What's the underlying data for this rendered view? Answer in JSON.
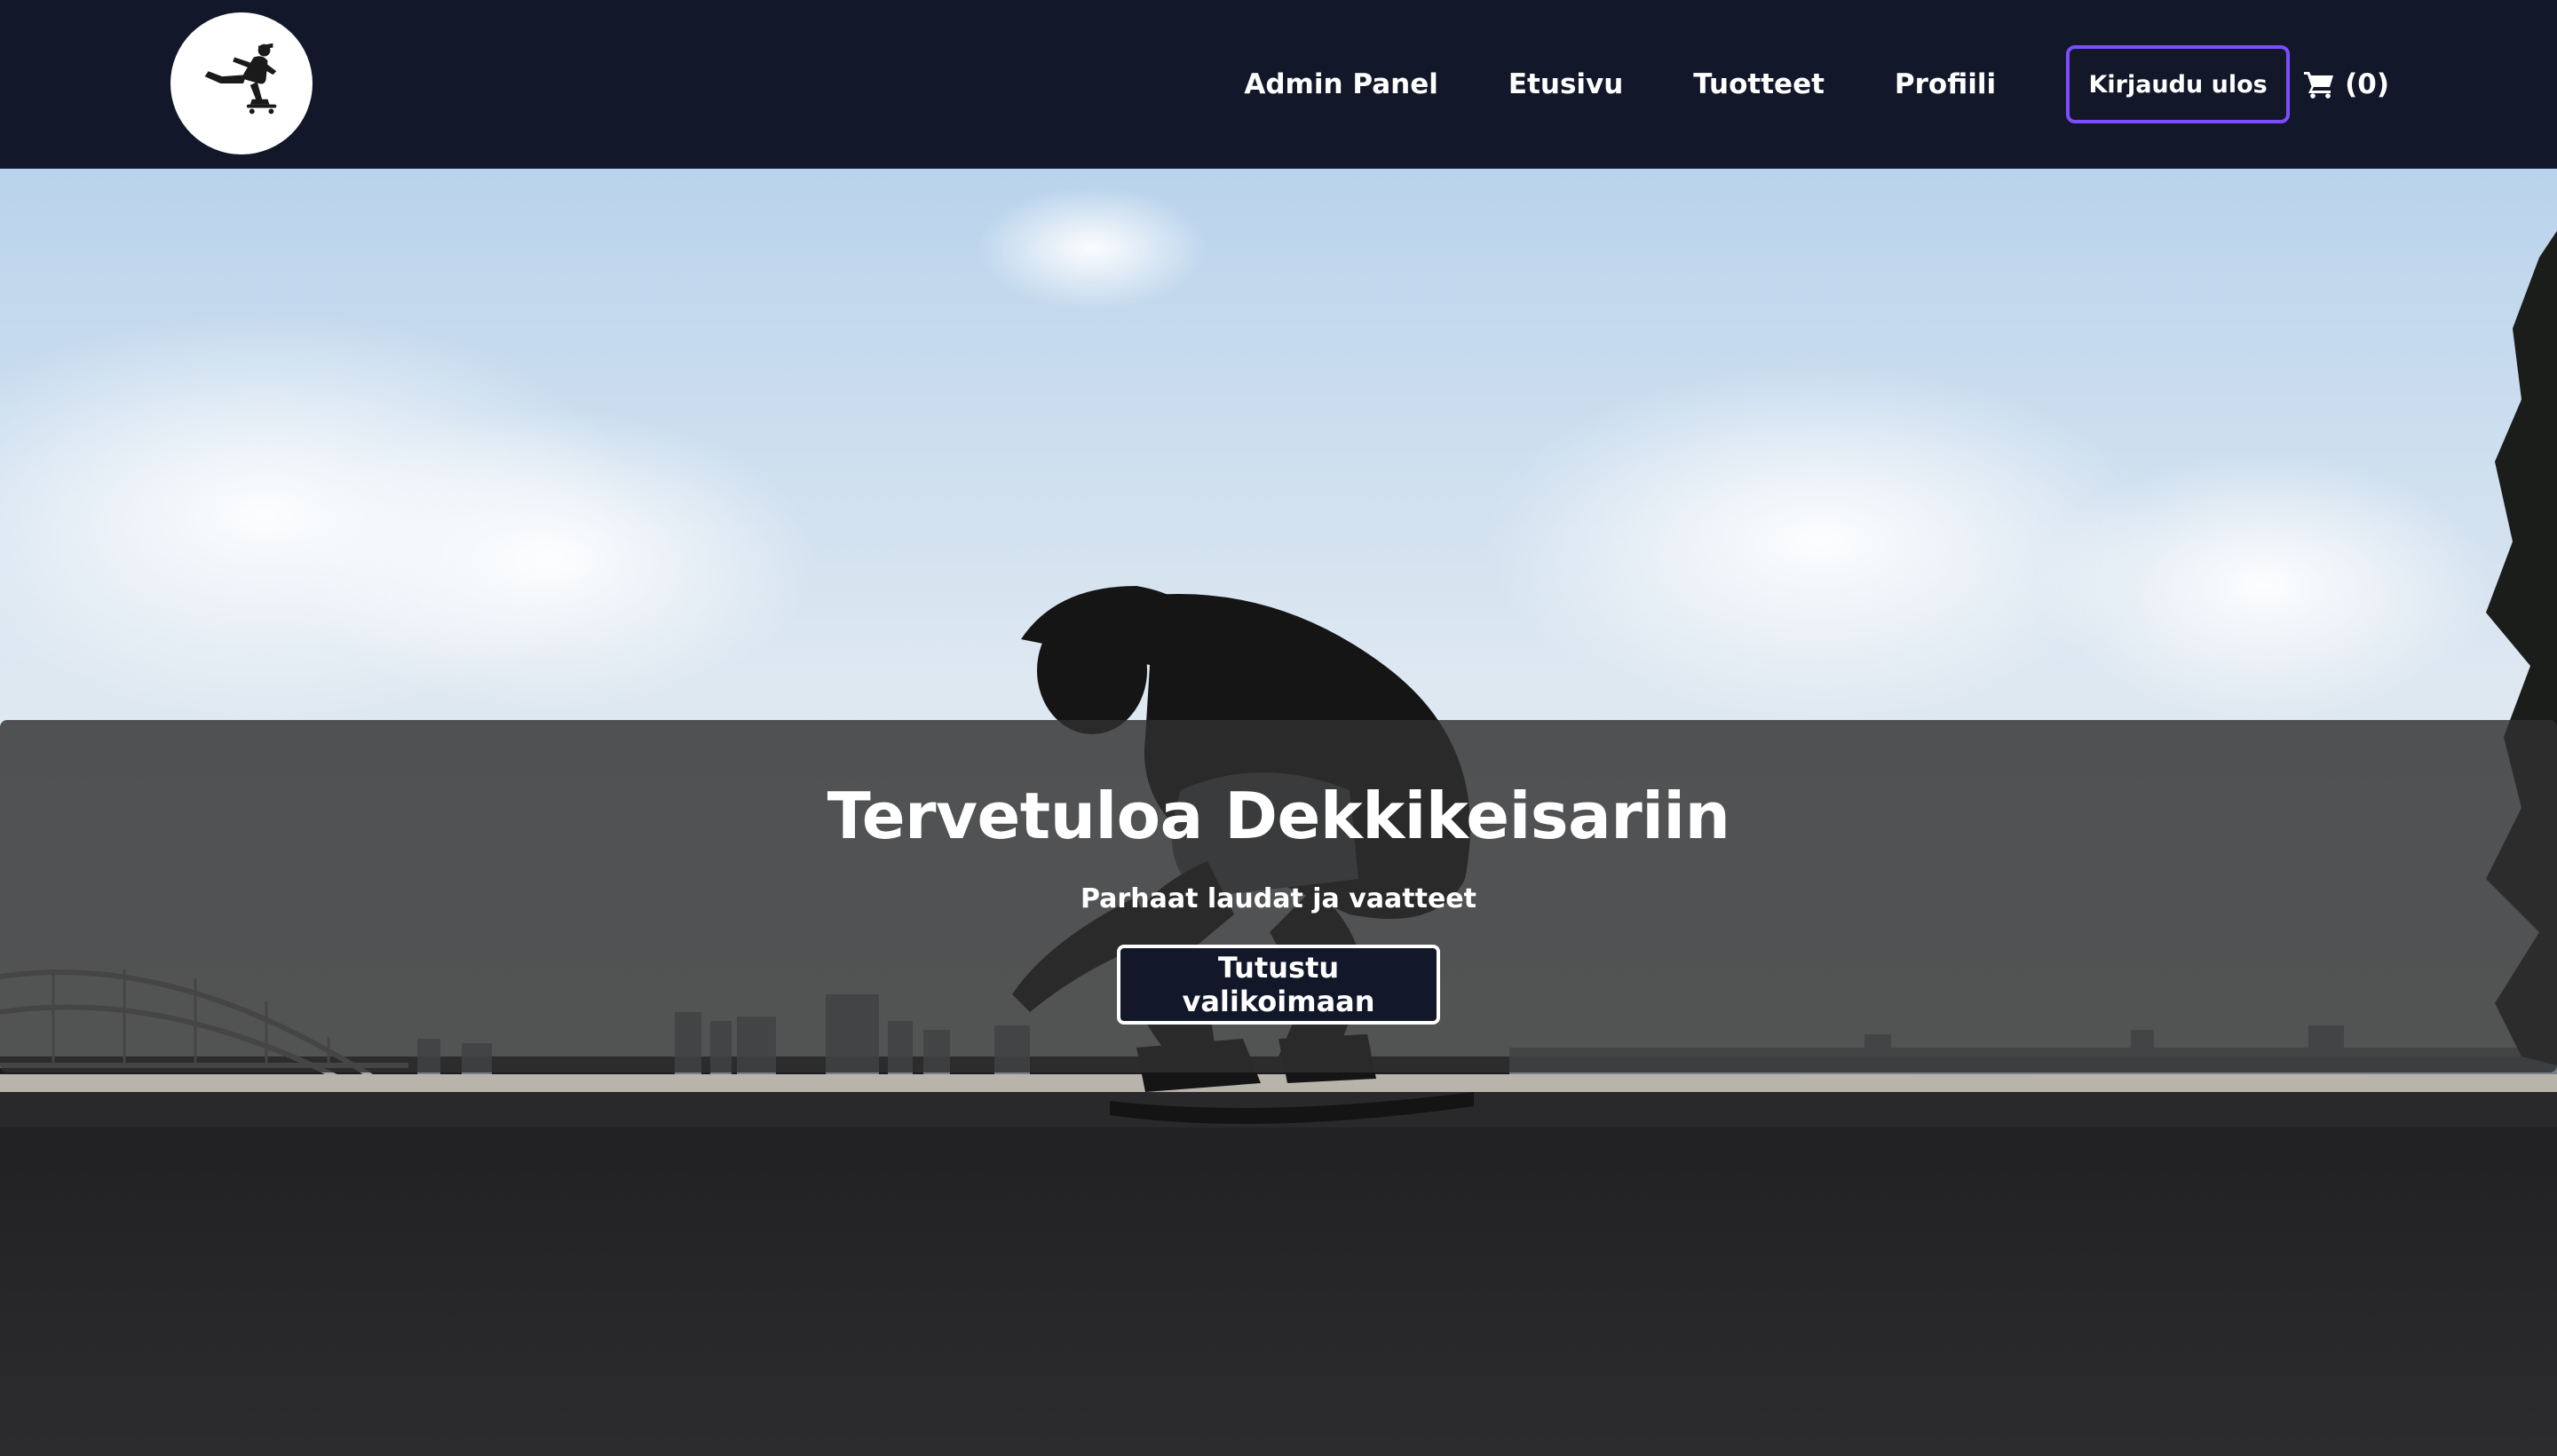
{
  "navbar": {
    "logo_icon": "skateboarder-logo-icon",
    "links": {
      "admin": "Admin Panel",
      "home": "Etusivu",
      "products": "Tuotteet",
      "profile": "Profiili"
    },
    "logout_label": "Kirjaudu ulos",
    "cart_icon": "cart-icon",
    "cart_count": "(0)"
  },
  "hero": {
    "title": "Tervetuloa Dekkikeisariin",
    "subtitle": "Parhaat laudat ja vaatteet",
    "cta_label": "Tutustu valikoimaan",
    "background": "skateboarder-jump-photo"
  },
  "colors": {
    "navbar_bg": "#121829",
    "logout_border": "#7c4dff",
    "overlay": "rgba(48,48,48,0.82)",
    "cta_bg": "#121829"
  }
}
